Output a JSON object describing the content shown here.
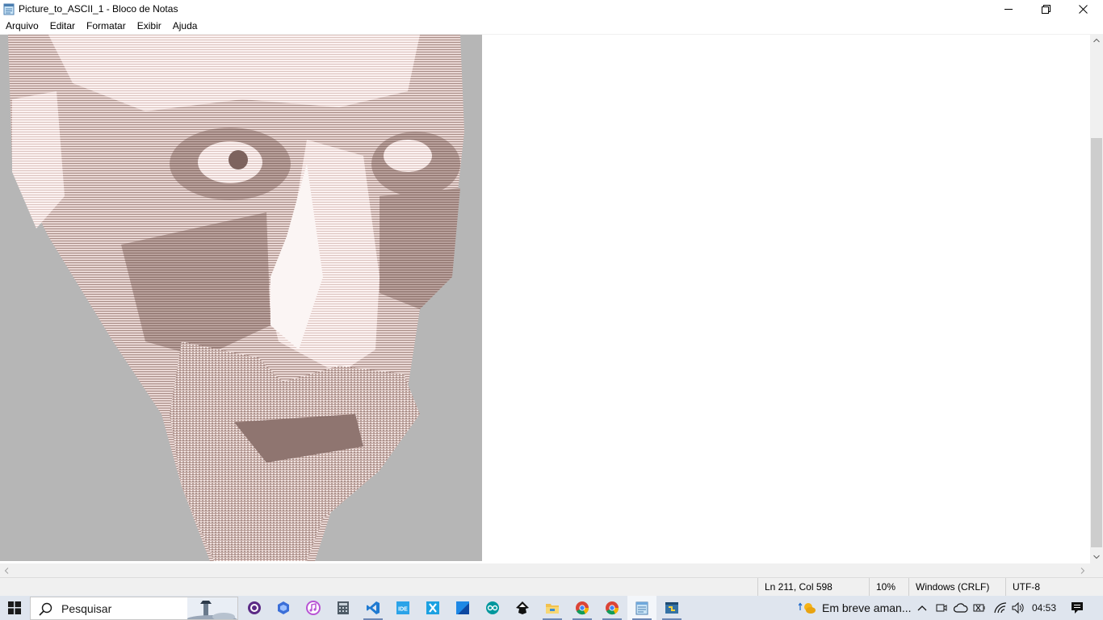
{
  "window": {
    "title": "Picture_to_ASCII_1 - Bloco de Notas",
    "caption_buttons": {
      "minimize": "—",
      "maximize": "❐",
      "close": "✕"
    }
  },
  "menu": [
    {
      "label": "Arquivo"
    },
    {
      "label": "Editar"
    },
    {
      "label": "Formatar"
    },
    {
      "label": "Exibir"
    },
    {
      "label": "Ajuda"
    }
  ],
  "editor": {
    "content_description": "ascii-art-portrait-image",
    "art_background": "#b6b6b6",
    "art_light": "#fdf3f3",
    "art_dark": "#9a7f79"
  },
  "statusbar": {
    "position": "Ln 211, Col 598",
    "zoom": "10%",
    "line_ending": "Windows (CRLF)",
    "encoding": "UTF-8"
  },
  "taskbar": {
    "search_placeholder": "Pesquisar",
    "apps": [
      {
        "name": "obs-icon",
        "color": "#5b2a86"
      },
      {
        "name": "settings-cube-icon",
        "color": "#3b6fd8"
      },
      {
        "name": "itunes-icon",
        "color": "#b854d4"
      },
      {
        "name": "calculator-icon",
        "color": "#4f5b66"
      },
      {
        "name": "vscode-icon",
        "color": "#1f7ad1"
      },
      {
        "name": "ide-icon",
        "color": "#2aa3e8"
      },
      {
        "name": "excel-x-icon",
        "color": "#1ba1e2"
      },
      {
        "name": "sublime-s-icon",
        "color": "#1e88e5"
      },
      {
        "name": "arduino-icon",
        "color": "#00979d"
      },
      {
        "name": "inkscape-icon",
        "color": "#111111"
      },
      {
        "name": "file-explorer-icon",
        "color": "#f2c14e"
      },
      {
        "name": "chrome-icon",
        "color": "#db4437"
      },
      {
        "name": "chrome-profile-icon",
        "color": "#db4437"
      },
      {
        "name": "notepad-icon",
        "color": "#6fa8dc"
      },
      {
        "name": "python-idle-icon",
        "color": "#3572a5"
      }
    ],
    "weather": "Em breve aman...",
    "clock": "04:53"
  }
}
